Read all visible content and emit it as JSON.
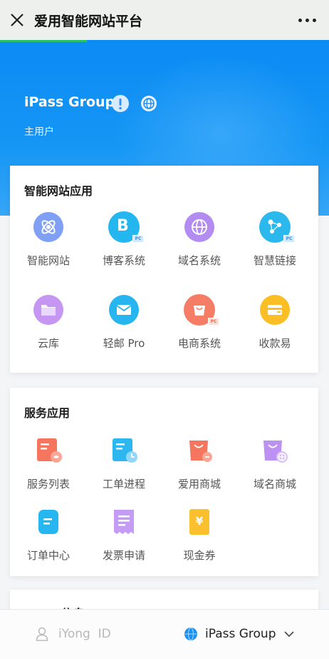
{
  "topbar": {
    "title": "爱用智能网站平台"
  },
  "hero": {
    "org_name": "iPass Group",
    "role": "主用户"
  },
  "smart_apps": {
    "title": "智能网站应用",
    "items": [
      {
        "label": "智能网站",
        "icon": "smart-website-icon"
      },
      {
        "label": "博客系统",
        "icon": "blog-icon"
      },
      {
        "label": "域名系统",
        "icon": "domain-icon"
      },
      {
        "label": "智慧链接",
        "icon": "smart-link-icon"
      },
      {
        "label": "云库",
        "icon": "cloud-folder-icon"
      },
      {
        "label": "轻邮 Pro",
        "icon": "mail-icon"
      },
      {
        "label": "电商系统",
        "icon": "ecommerce-icon"
      },
      {
        "label": "收款易",
        "icon": "payment-icon"
      }
    ]
  },
  "service_apps": {
    "title": "服务应用",
    "items": [
      {
        "label": "服务列表",
        "icon": "service-list-icon"
      },
      {
        "label": "工单进程",
        "icon": "ticket-progress-icon"
      },
      {
        "label": "爱用商城",
        "icon": "shop-icon"
      },
      {
        "label": "域名商城",
        "icon": "domain-shop-icon"
      },
      {
        "label": "订单中心",
        "icon": "order-center-icon"
      },
      {
        "label": "发票申请",
        "icon": "invoice-icon"
      },
      {
        "label": "现金券",
        "icon": "cash-coupon-icon"
      }
    ]
  },
  "next_section": {
    "title": "iPass 信息"
  },
  "bottombar": {
    "user_id_label": "iYong  ID",
    "org_label": "iPass Group"
  },
  "colors": {
    "hero_blue": "#0b8bf4",
    "progress_green": "#2bc06a"
  }
}
